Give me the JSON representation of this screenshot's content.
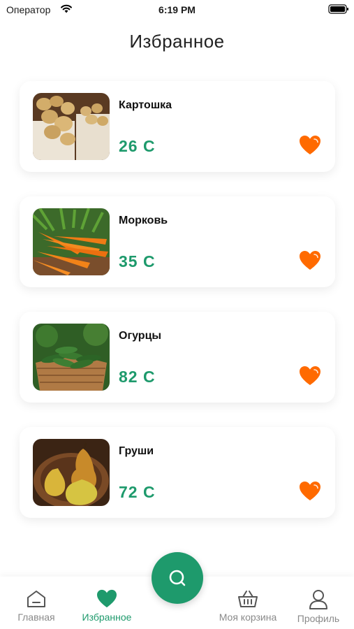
{
  "status_bar": {
    "carrier": "Оператор",
    "time": "6:19 PM"
  },
  "page": {
    "title": "Избранное"
  },
  "favorites": [
    {
      "name": "Картошка",
      "price": "26 С",
      "image": "potatoes",
      "liked": true
    },
    {
      "name": "Морковь",
      "price": "35 С",
      "image": "carrots",
      "liked": true
    },
    {
      "name": "Огурцы",
      "price": "82 С",
      "image": "cucumbers",
      "liked": true
    },
    {
      "name": "Груши",
      "price": "72 С",
      "image": "pears",
      "liked": true
    }
  ],
  "bottom_nav": {
    "items": [
      {
        "label": "Главная",
        "icon": "home-icon",
        "active": false
      },
      {
        "label": "Избранное",
        "icon": "heart-icon",
        "active": true
      },
      {
        "label": "Моя корзина",
        "icon": "basket-icon",
        "active": false
      },
      {
        "label": "Профиль",
        "icon": "user-icon",
        "active": false
      }
    ],
    "fab_icon": "search-icon"
  },
  "colors": {
    "accent": "#1e9a6c",
    "heart": "#ff6a00"
  }
}
